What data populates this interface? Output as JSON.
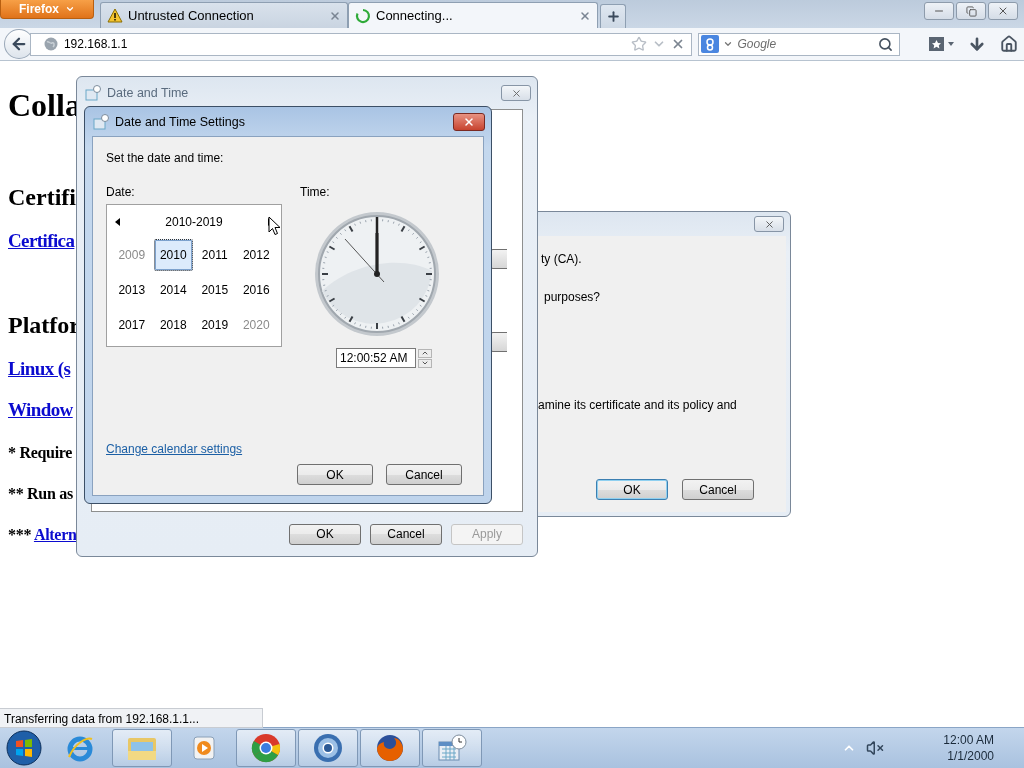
{
  "browser": {
    "menu_button": "Firefox",
    "tabs": [
      {
        "kind": "warning",
        "title": "Untrusted Connection",
        "selected": false
      },
      {
        "kind": "loading",
        "title": "Connecting...",
        "selected": true
      }
    ],
    "address": "192.168.1.1",
    "search_placeholder": "Google"
  },
  "page": {
    "blocks": [
      {
        "kind": "h1",
        "text": "Colla"
      },
      {
        "kind": "h2",
        "text": "Certifi"
      },
      {
        "kind": "link",
        "text": "Certifica"
      },
      {
        "kind": "h2",
        "text": "Platfor"
      },
      {
        "kind": "link",
        "text": "Linux (s"
      },
      {
        "kind": "link",
        "text": "Window"
      },
      {
        "kind": "note",
        "text": "* Require"
      },
      {
        "kind": "note",
        "text": "** Run as"
      },
      {
        "kind": "note",
        "text": "*** ",
        "link": "Altern"
      }
    ]
  },
  "status": "Transferring data from 192.168.1.1...",
  "certificate_dialog": {
    "lines": [
      "ty (CA).",
      "purposes?",
      "amine its certificate and its policy and"
    ],
    "buttons": [
      {
        "label": "OK",
        "focused": true
      },
      {
        "label": "Cancel",
        "focused": false
      }
    ]
  },
  "date_time_window": {
    "title": "Date and Time",
    "buttons": [
      {
        "label": "OK",
        "disabled": false
      },
      {
        "label": "Cancel",
        "disabled": false
      },
      {
        "label": "Apply",
        "disabled": true
      }
    ]
  },
  "settings_dialog": {
    "title": "Date and Time Settings",
    "prompt": "Set the date and time:",
    "date_label": "Date:",
    "time_label": "Time:",
    "calendar": {
      "range": "2010-2019",
      "years": [
        {
          "label": "2009",
          "selected": false,
          "dimmed": true
        },
        {
          "label": "2010",
          "selected": true,
          "dimmed": false
        },
        {
          "label": "2011",
          "selected": false,
          "dimmed": false
        },
        {
          "label": "2012",
          "selected": false,
          "dimmed": false
        },
        {
          "label": "2013",
          "selected": false,
          "dimmed": false
        },
        {
          "label": "2014",
          "selected": false,
          "dimmed": false
        },
        {
          "label": "2015",
          "selected": false,
          "dimmed": false
        },
        {
          "label": "2016",
          "selected": false,
          "dimmed": false
        },
        {
          "label": "2017",
          "selected": false,
          "dimmed": false
        },
        {
          "label": "2018",
          "selected": false,
          "dimmed": false
        },
        {
          "label": "2019",
          "selected": false,
          "dimmed": false
        },
        {
          "label": "2020",
          "selected": false,
          "dimmed": true
        }
      ]
    },
    "time_value": "12:00:52 AM",
    "link": "Change calendar settings",
    "buttons": [
      {
        "label": "OK"
      },
      {
        "label": "Cancel"
      }
    ]
  },
  "taskbar": {
    "apps": [
      {
        "kind": "ie",
        "running": false
      },
      {
        "kind": "explorer",
        "running": true
      },
      {
        "kind": "media",
        "running": false
      },
      {
        "kind": "chrome",
        "running": true
      },
      {
        "kind": "chromium",
        "running": true
      },
      {
        "kind": "firefox",
        "running": true
      },
      {
        "kind": "datetime",
        "running": true
      }
    ],
    "clock": {
      "time": "12:00 AM",
      "date": "1/1/2000"
    }
  }
}
